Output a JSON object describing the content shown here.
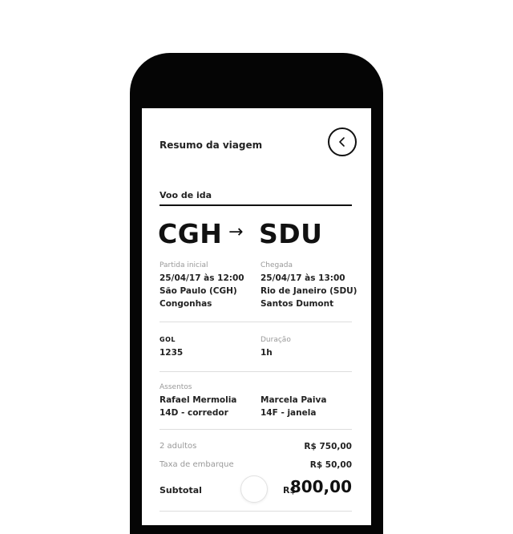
{
  "header": {
    "title": "Resumo da viagem"
  },
  "flight": {
    "section_label": "Voo de ida",
    "origin_code": "CGH",
    "arrow": "→",
    "destination_code": "SDU",
    "departure": {
      "caption": "Partida inicial",
      "datetime": "25/04/17 às 12:00",
      "city": "São Paulo (CGH)",
      "airport": "Congonhas"
    },
    "arrival": {
      "caption": "Chegada",
      "datetime": "25/04/17 às 13:00",
      "city": "Rio de Janeiro (SDU)",
      "airport": "Santos Dumont"
    },
    "airline": {
      "logo_text": "GOL",
      "flight_number": "1235"
    },
    "duration": {
      "caption": "Duração",
      "value": "1h"
    }
  },
  "seats": {
    "caption": "Assentos",
    "passengers": [
      {
        "name": "Rafael Mermolia",
        "seat": "14D - corredor"
      },
      {
        "name": "Marcela Paiva",
        "seat": "14F - janela"
      }
    ]
  },
  "pricing": {
    "lines": [
      {
        "label": "2 adultos",
        "value": "R$ 750,00"
      },
      {
        "label": "Taxa de embarque",
        "value": "R$ 50,00"
      }
    ],
    "subtotal_label": "Subtotal",
    "subtotal_currency": "R$",
    "subtotal_value": "800,00"
  },
  "colors": {
    "phone_frame": "#050505",
    "text_primary": "#111111",
    "text_muted": "#999999",
    "divider": "#dddddd"
  },
  "icons": {
    "back": "chevron-left-icon"
  }
}
